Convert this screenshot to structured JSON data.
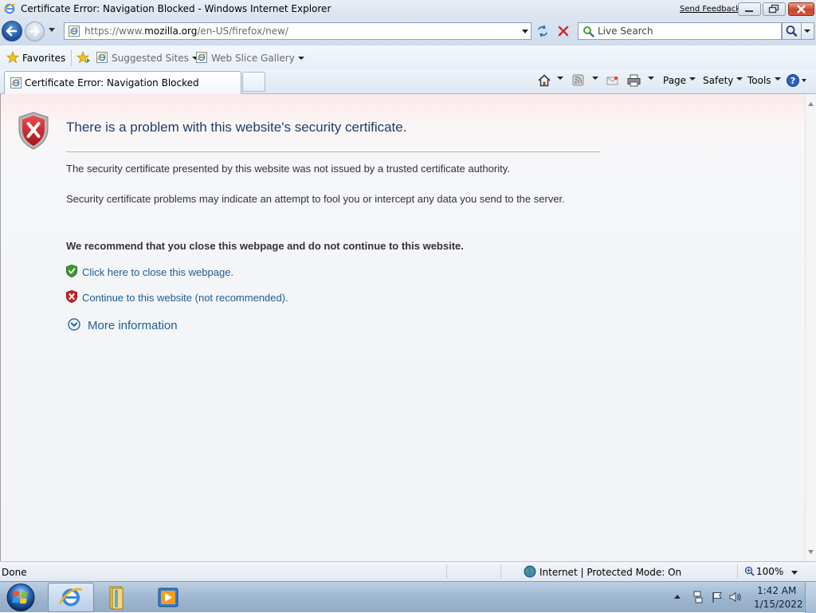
{
  "window": {
    "title": "Certificate Error: Navigation Blocked - Windows Internet Explorer",
    "send_feedback": "Send Feedback",
    "controls": [
      "minimize",
      "maximize",
      "close"
    ]
  },
  "navigation": {
    "address_prefix": "https://www.",
    "address_domain": "mozilla.org",
    "address_suffix": "/en-US/firefox/new/",
    "search_placeholder": "Live Search",
    "icons": [
      "back-arrow-icon",
      "forward-arrow-icon",
      "ie-page-icon",
      "refresh-icon",
      "stop-icon",
      "search-icon"
    ]
  },
  "favorites_bar": {
    "favorites_label": "Favorites",
    "suggested_sites": "Suggested Sites",
    "web_slice_gallery": "Web Slice Gallery"
  },
  "tabs": {
    "active_label": "Certificate Error: Navigation Blocked"
  },
  "command_bar": {
    "page": "Page",
    "safety": "Safety",
    "tools": "Tools"
  },
  "content": {
    "title": "There is a problem with this website's security certificate.",
    "paragraph1": "The security certificate presented by this website was not issued by a trusted certificate authority.",
    "paragraph2": "Security certificate problems may indicate an attempt to fool you or intercept any data you send to the server.",
    "recommendation": "We recommend that you close this webpage and do not continue to this website.",
    "close_link": "Click here to close this webpage.",
    "continue_link": "Continue to this website (not recommended).",
    "more_information": "More information",
    "colors": {
      "title": "#1f3d6e",
      "link": "#1e5c96",
      "shield_red": "#c8262a",
      "shield_green": "#3d9a2f"
    }
  },
  "status_bar": {
    "status": "Done",
    "zone": "Internet | Protected Mode: On",
    "zoom": "100%"
  },
  "taskbar": {
    "time": "1:42 AM",
    "date": "1/15/2022",
    "apps": [
      "internet-explorer",
      "windows-explorer",
      "windows-media-player"
    ]
  }
}
